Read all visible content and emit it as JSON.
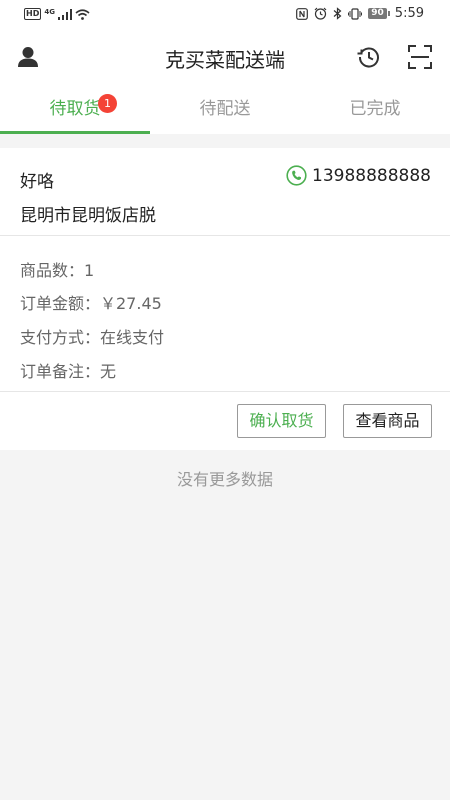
{
  "status_bar": {
    "hd": "HD",
    "network": "4G",
    "battery": "90",
    "time": "5:59"
  },
  "header": {
    "title": "克买菜配送端"
  },
  "tabs": [
    {
      "label": "待取货",
      "badge": "1"
    },
    {
      "label": "待配送"
    },
    {
      "label": "已完成"
    }
  ],
  "order": {
    "customer_name": "好咯",
    "phone": "13988888888",
    "address": "昆明市昆明饭店脱",
    "details": [
      "商品数：1",
      "订单金额：￥27.45",
      "支付方式：在线支付",
      "订单备注：无"
    ],
    "confirm_button": "确认取货",
    "view_button": "查看商品"
  },
  "no_more_text": "没有更多数据",
  "colors": {
    "accent": "#4caf50",
    "badge": "#f44336"
  }
}
